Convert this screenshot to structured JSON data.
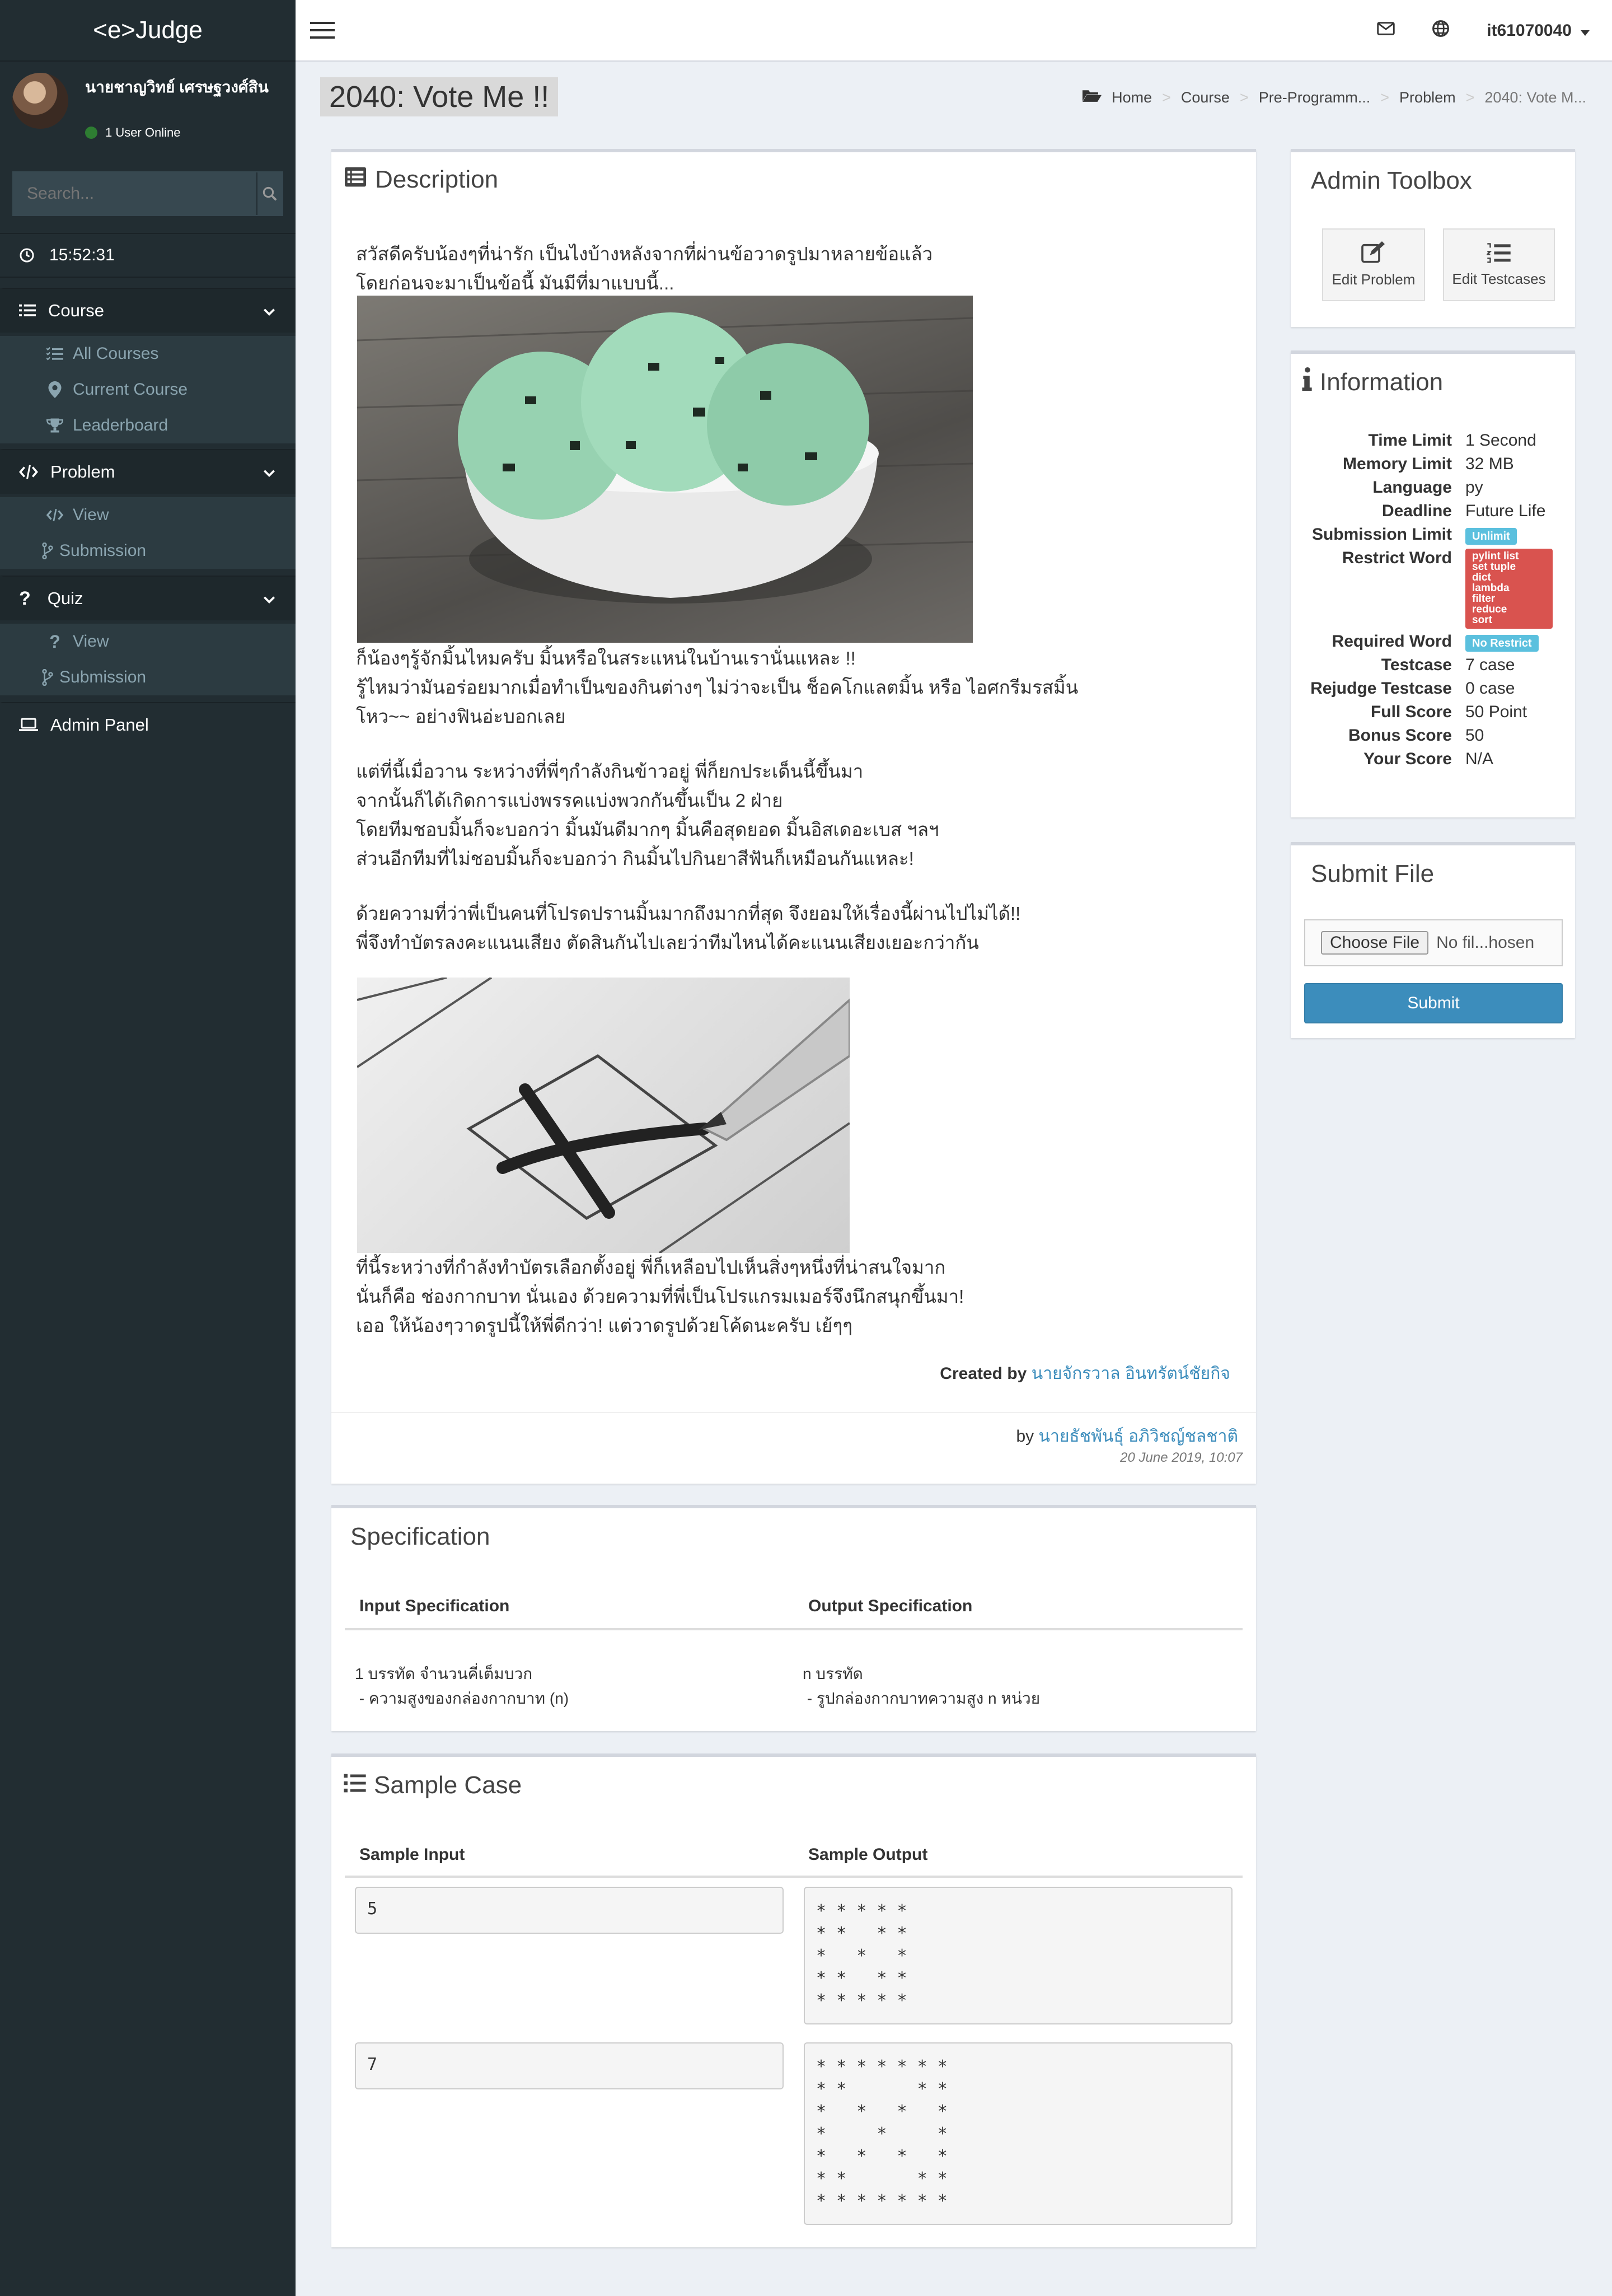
{
  "brand": "<e>Judge",
  "user": {
    "name": "นายชาญวิทย์ เศรษฐวงศ์สิน",
    "status": "1 User Online"
  },
  "search": {
    "placeholder": "Search..."
  },
  "clock": "15:52:31",
  "menu": {
    "course": {
      "label": "Course",
      "items": [
        "All Courses",
        "Current Course",
        "Leaderboard"
      ]
    },
    "problem": {
      "label": "Problem",
      "items": [
        "View",
        "Submission"
      ]
    },
    "quiz": {
      "label": "Quiz",
      "items": [
        "View",
        "Submission"
      ]
    },
    "admin": "Admin Panel"
  },
  "topbar": {
    "username": "it61070040"
  },
  "page": {
    "title": "2040: Vote Me !!"
  },
  "breadcrumb": [
    "Home",
    "Course",
    "Pre-Programm...",
    "Problem",
    "2040: Vote M..."
  ],
  "description": {
    "title": "Description",
    "p1": [
      "สวัสดีครับน้องๆที่น่ารัก เป็นไงบ้างหลังจากที่ผ่านข้อวาดรูปมาหลายข้อแล้ว",
      "โดยก่อนจะมาเป็นข้อนี้ มันมีที่มาแบบนี้..."
    ],
    "p2": [
      "ก็น้องๆรู้จักมิ้นไหมครับ มิ้นหรือในสระแหน่ในบ้านเรานั่นแหละ !!",
      "รู้ไหมว่ามันอร่อยมากเมื่อทำเป็นของกินต่างๆ ไม่ว่าจะเป็น ช็อคโกแลตมิ้น หรือ ไอศกรีมรสมิ้น",
      "โหว~~ อย่างฟินอ่ะบอกเลย"
    ],
    "p3": [
      "แต่ที่นี้เมื่อวาน ระหว่างที่พี่ๆกำลังกินข้าวอยู่ พี่ก็ยกประเด็นนี้ขึ้นมา",
      "จากนั้นก็ได้เกิดการแบ่งพรรคแบ่งพวกกันขึ้นเป็น 2 ฝ่าย",
      "โดยทีมชอบมิ้นก็จะบอกว่า มิ้นมันดีมากๆ มิ้นคือสุดยอด มิ้นอิสเดอะเบส ฯลฯ",
      "ส่วนอีกทีมที่ไม่ชอบมิ้นก็จะบอกว่า กินมิ้นไปกินยาสีฟันก็เหมือนกันแหละ!"
    ],
    "p4": [
      "ด้วยความที่ว่าพี่เป็นคนที่โปรดปรานมิ้นมากถึงมากที่สุด จึงยอมให้เรื่องนี้ผ่านไปไม่ได้!!",
      "พี่จึงทำบัตรลงคะแนนเสียง ตัดสินกันไปเลยว่าทีมไหนได้คะแนนเสียงเยอะกว่ากัน"
    ],
    "p5": [
      "ที่นี้ระหว่างที่กำลังทำบัตรเลือกตั้งอยู่ พี่ก็เหลือบไปเห็นสิ่งๆหนึ่งที่น่าสนใจมาก",
      "นั่นก็คือ ช่องกากบาท นั่นเอง ด้วยความที่พี่เป็นโปรแกรมเมอร์จึงนึกสนุกขึ้นมา!",
      "เออ ให้น้องๆวาดรูปนี้ให้พี่ดีกว่า! แต่วาดรูปด้วยโค้ดนะครับ เย้ๆๆ"
    ],
    "created_by_label": "Created by",
    "created_by": "นายจักรวาล อินทรัตน์ชัยกิจ",
    "by_label": "by",
    "author": "นายธัชพันธุ์ อภิวิชญ์ชลชาติ",
    "date": "20 June 2019, 10:07"
  },
  "specification": {
    "title": "Specification",
    "input_head": "Input Specification",
    "output_head": "Output Specification",
    "input_lines": [
      "1 บรรทัด จำนวนคี่เต็มบวก",
      " - ความสูงของกล่องกากบาท (n)"
    ],
    "output_lines": [
      "n บรรทัด",
      " - รูปกล่องกากบาทความสูง n หน่วย"
    ]
  },
  "samples": {
    "title": "Sample Case",
    "input_head": "Sample Input",
    "output_head": "Sample Output",
    "cases": [
      {
        "input": "5",
        "output": "* * * * *\n* *   * *\n*   *   *\n* *   * *\n* * * * *"
      },
      {
        "input": "7",
        "output": "* * * * * * *\n* *       * *\n*   *   *   *\n*     *     *\n*   *   *   *\n* *       * *\n* * * * * * *"
      }
    ]
  },
  "admin_toolbox": {
    "title": "Admin Toolbox",
    "edit_problem": "Edit Problem",
    "edit_testcases": "Edit Testcases"
  },
  "information": {
    "title": "Information",
    "rows": [
      {
        "k": "Time Limit",
        "v": "1 Second"
      },
      {
        "k": "Memory Limit",
        "v": "32 MB"
      },
      {
        "k": "Language",
        "v": "py"
      },
      {
        "k": "Deadline",
        "v": "Future Life"
      }
    ],
    "submission_limit_label": "Submission Limit",
    "submission_limit": "Unlimit",
    "restrict_word_label": "Restrict Word",
    "restrict_words": [
      "pylint list",
      "set tuple",
      "dict",
      "lambda",
      "filter",
      "reduce",
      "sort"
    ],
    "required_word_label": "Required Word",
    "required_word": "No Restrict",
    "rows2": [
      {
        "k": "Testcase",
        "v": "7 case"
      },
      {
        "k": "Rejudge Testcase",
        "v": "0 case"
      },
      {
        "k": "Full Score",
        "v": "50 Point"
      },
      {
        "k": "Bonus Score",
        "v": "50"
      },
      {
        "k": "Your Score",
        "v": "N/A"
      }
    ]
  },
  "submit_file": {
    "title": "Submit File",
    "choose": "Choose File",
    "no_file": "No fil...hosen",
    "submit": "Submit"
  },
  "colors": {
    "sidebar": "#222d32",
    "primary": "#3c8dbc",
    "badge_info": "#5bc0de",
    "badge_danger": "#d9534f"
  }
}
